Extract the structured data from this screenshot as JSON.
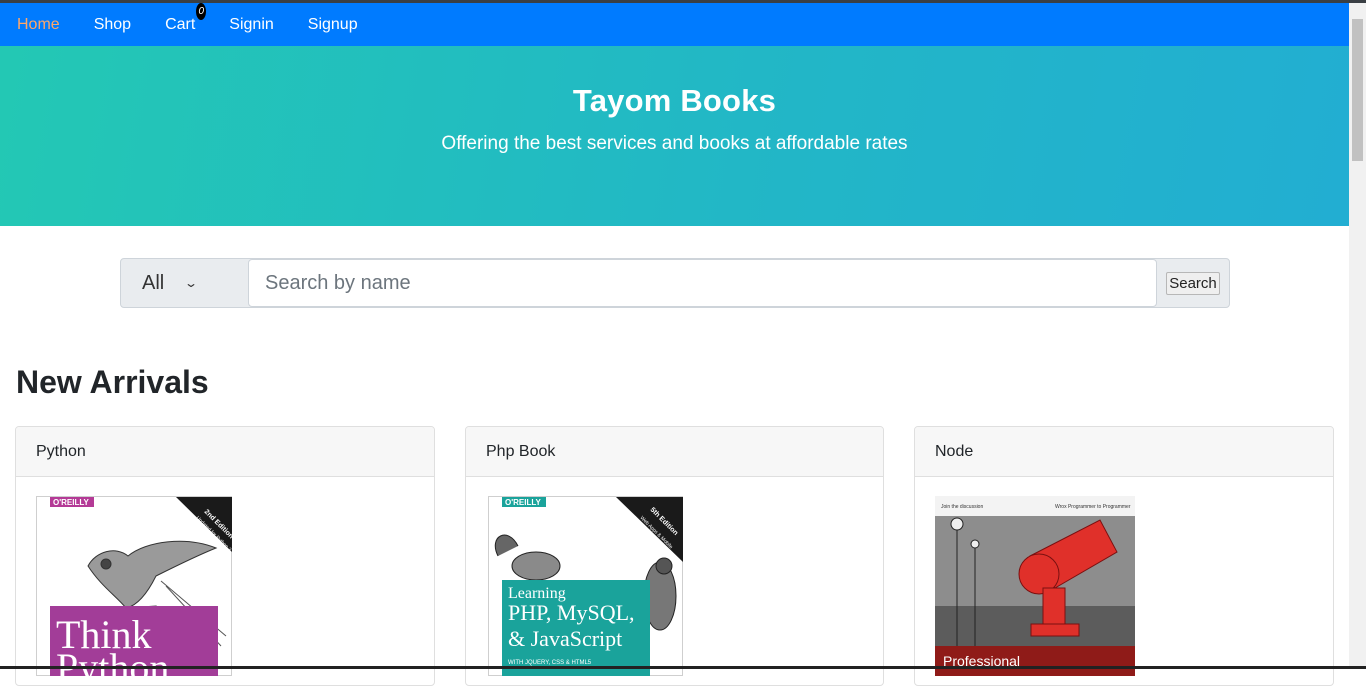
{
  "nav": {
    "items": [
      {
        "label": "Home",
        "active": true
      },
      {
        "label": "Shop"
      },
      {
        "label": "Cart"
      },
      {
        "label": "Signin"
      },
      {
        "label": "Signup"
      }
    ],
    "cart_count": "0"
  },
  "hero": {
    "title": "Tayom Books",
    "subtitle": "Offering the best services and books at affordable rates"
  },
  "search": {
    "category": "All",
    "placeholder": "Search by name",
    "button_label": "Search"
  },
  "section_title": "New Arrivals",
  "books": [
    {
      "name": "Python"
    },
    {
      "name": "Php Book"
    },
    {
      "name": "Node"
    }
  ],
  "colors": {
    "nav_bg": "#007bff",
    "nav_active": "#ffa768",
    "hero_start": "#23c8b4",
    "hero_end": "#22aed2"
  }
}
